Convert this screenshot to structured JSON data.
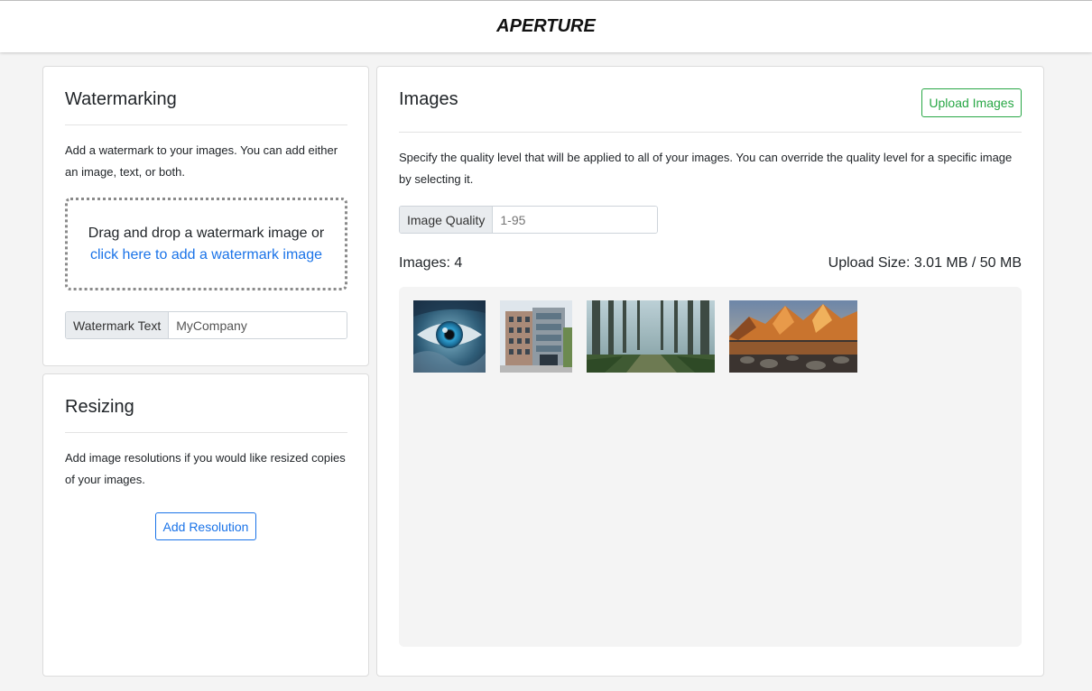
{
  "app": {
    "brand": "APERTURE"
  },
  "watermarking": {
    "title": "Watermarking",
    "description": "Add a watermark to your images. You can add either an image, text, or both.",
    "dropzone_text": "Drag and drop a watermark image or",
    "dropzone_link": "click here to add a watermark image",
    "text_label": "Watermark Text",
    "text_value": "MyCompany"
  },
  "resizing": {
    "title": "Resizing",
    "description": "Add image resolutions if you would like resized copies of your images.",
    "add_button": "Add Resolution"
  },
  "images": {
    "title": "Images",
    "upload_button": "Upload Images",
    "description": "Specify the quality level that will be applied to all of your images. You can override the quality level for a specific image by selecting it.",
    "quality_label": "Image Quality",
    "quality_placeholder": "1-95",
    "count_text": "Images: 4",
    "upload_size_text": "Upload Size: 3.01 MB / 50 MB",
    "thumbnails": [
      {
        "name": "eye-image"
      },
      {
        "name": "building-image"
      },
      {
        "name": "forest-image"
      },
      {
        "name": "mountain-lake-image"
      }
    ]
  },
  "colors": {
    "accent_blue": "#1a73e8",
    "accent_green": "#28a745"
  }
}
